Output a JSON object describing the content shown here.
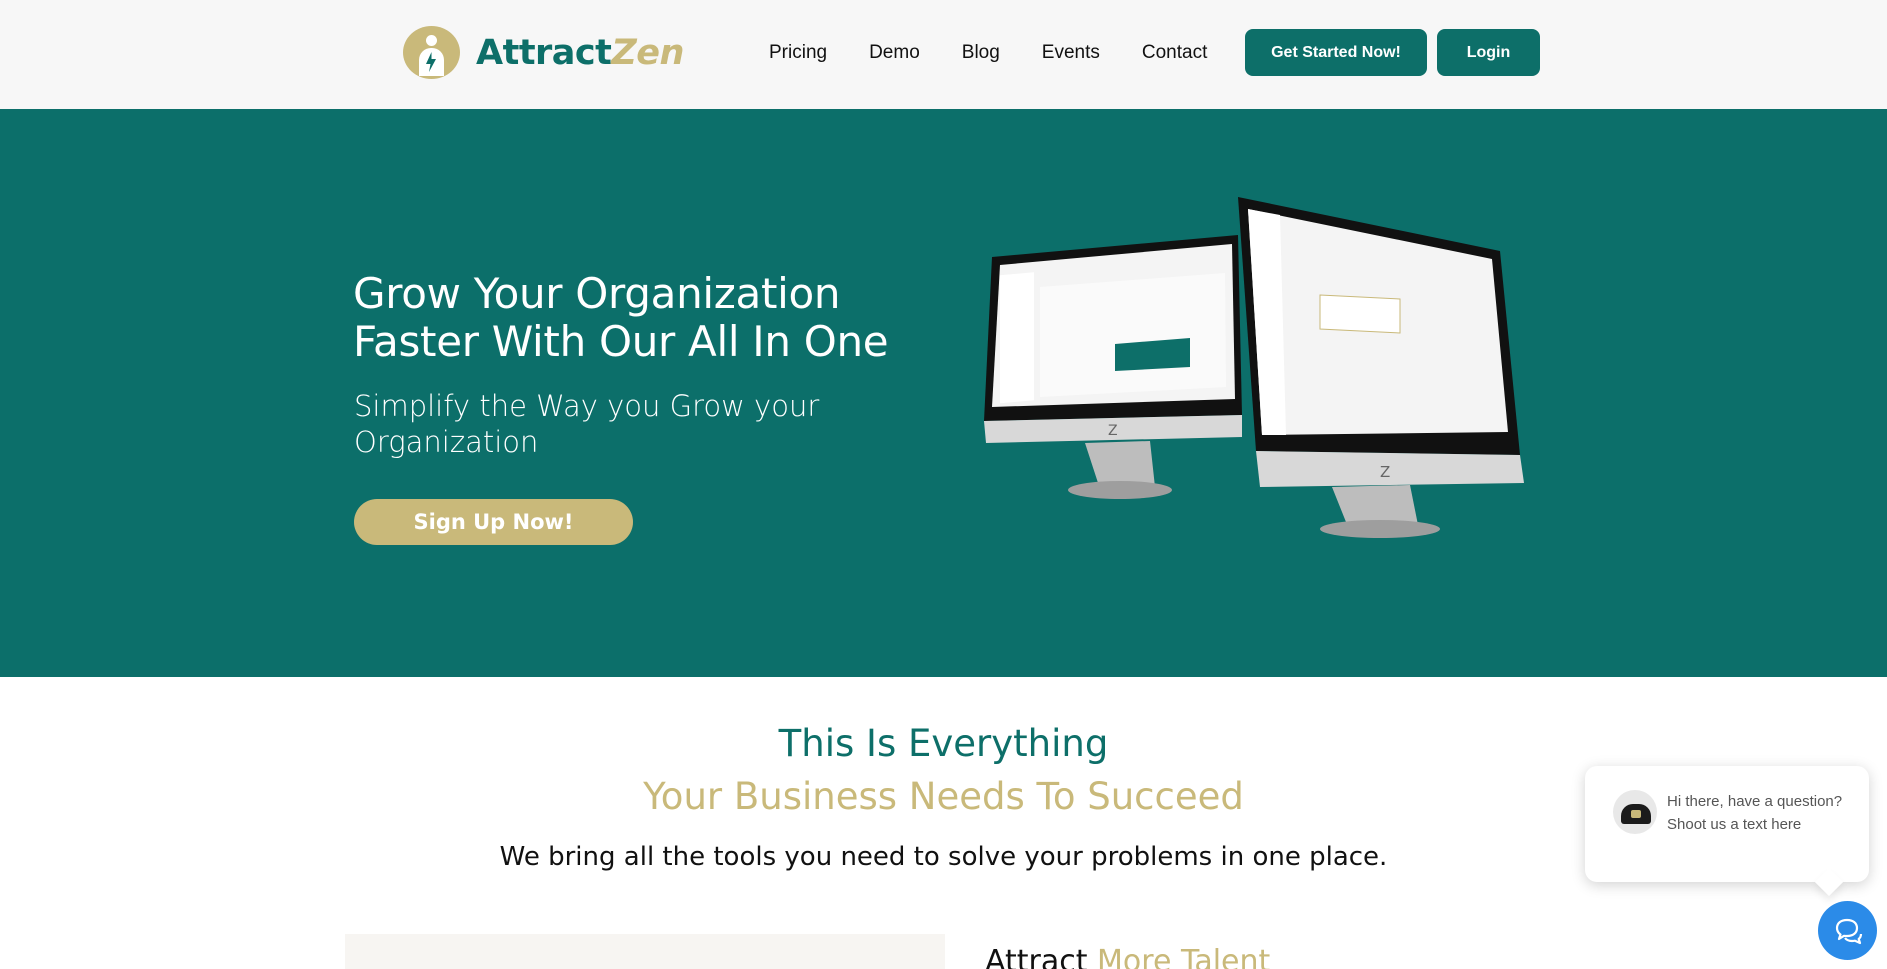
{
  "brand": {
    "name_part1": "Attract",
    "name_part2": "Zen",
    "primary": "#0d6f69",
    "accent": "#c9b97a"
  },
  "nav": {
    "items": [
      "Pricing",
      "Demo",
      "Blog",
      "Events",
      "Contact"
    ]
  },
  "header": {
    "get_started": "Get Started Now!",
    "login": "Login"
  },
  "hero": {
    "title": "Grow Your Organization Faster With Our All In One",
    "subtitle": "Simplify the Way you Grow your Organization",
    "cta": "Sign Up Now!"
  },
  "section": {
    "title_line1": "This Is Everything",
    "title_line2": "Your Business Needs To Succeed",
    "subtitle": "We bring all the tools you need to solve your problems in one place.",
    "feature_title_a": "Attract",
    "feature_title_b": "More Talent"
  },
  "chat": {
    "message": "Hi there, have a question? Shoot us a text here",
    "icon": "chat-icon",
    "color": "#2b8be8"
  }
}
